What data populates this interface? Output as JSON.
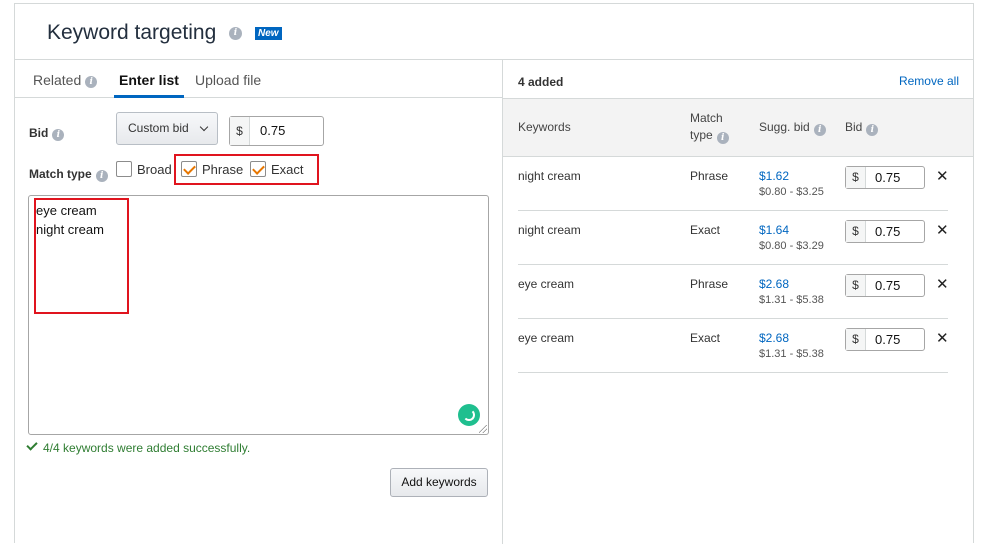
{
  "header": {
    "title": "Keyword targeting",
    "badge": "New"
  },
  "tabs": [
    {
      "label": "Related",
      "active": false
    },
    {
      "label": "Enter list",
      "active": true
    },
    {
      "label": "Upload file",
      "active": false
    }
  ],
  "bid": {
    "label": "Bid",
    "dropdown_value": "Custom bid",
    "currency": "$",
    "value": "0.75"
  },
  "match_type": {
    "label": "Match type",
    "options": [
      {
        "label": "Broad",
        "checked": false
      },
      {
        "label": "Phrase",
        "checked": true
      },
      {
        "label": "Exact",
        "checked": true
      }
    ]
  },
  "textarea": {
    "lines": [
      "eye cream",
      "night cream"
    ]
  },
  "status": {
    "success": "4/4 keywords were added successfully."
  },
  "add_button": "Add keywords",
  "results": {
    "count_label": "4 added",
    "remove_all": "Remove all",
    "columns": {
      "keywords": "Keywords",
      "match_type_l1": "Match",
      "match_type_l2": "type",
      "sugg_bid": "Sugg. bid",
      "bid": "Bid"
    },
    "rows": [
      {
        "keyword": "night cream",
        "match": "Phrase",
        "sugg": "$1.62",
        "range": "$0.80 - $3.25",
        "currency": "$",
        "bid": "0.75"
      },
      {
        "keyword": "night cream",
        "match": "Exact",
        "sugg": "$1.64",
        "range": "$0.80 - $3.29",
        "currency": "$",
        "bid": "0.75"
      },
      {
        "keyword": "eye cream",
        "match": "Phrase",
        "sugg": "$2.68",
        "range": "$1.31 - $5.38",
        "currency": "$",
        "bid": "0.75"
      },
      {
        "keyword": "eye cream",
        "match": "Exact",
        "sugg": "$2.68",
        "range": "$1.31 - $5.38",
        "currency": "$",
        "bid": "0.75"
      }
    ]
  },
  "colors": {
    "accent": "#0066c0",
    "check": "#e77600",
    "success": "#2f7d32",
    "highlight": "#e0141e",
    "spinner": "#1fbf8f"
  }
}
